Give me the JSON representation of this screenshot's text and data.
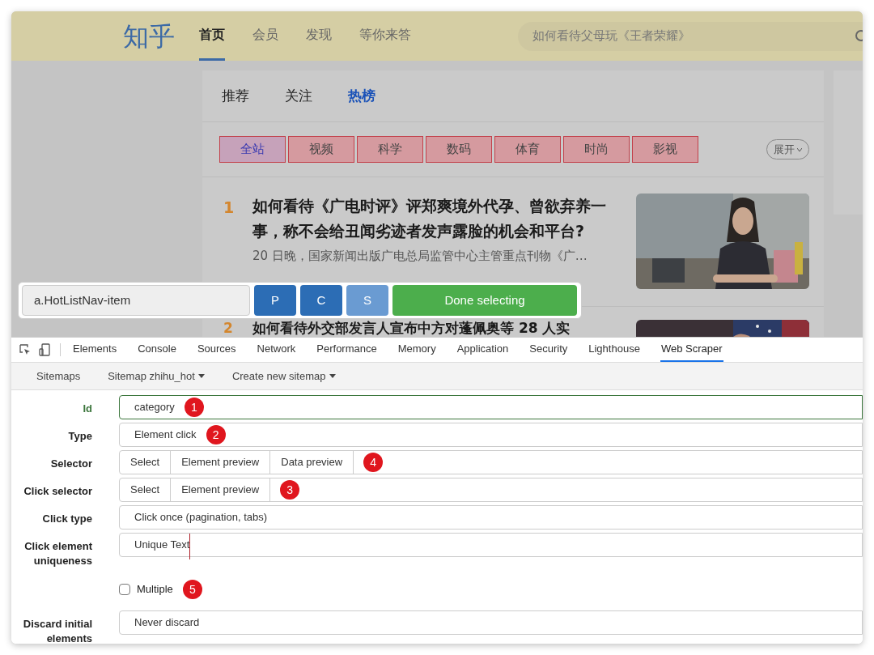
{
  "header": {
    "logo": "知乎",
    "nav": [
      {
        "label": "首页",
        "selected": true
      },
      {
        "label": "会员",
        "selected": false
      },
      {
        "label": "发现",
        "selected": false
      },
      {
        "label": "等你来答",
        "selected": false
      }
    ],
    "search": {
      "placeholder": "如何看待父母玩《王者荣耀》"
    }
  },
  "feed": {
    "tabs": [
      {
        "label": "推荐",
        "selected": false
      },
      {
        "label": "关注",
        "selected": false
      },
      {
        "label": "热榜",
        "selected": true
      }
    ],
    "categories": [
      {
        "label": "全站",
        "selected": true
      },
      {
        "label": "视频",
        "selected": false
      },
      {
        "label": "科学",
        "selected": false
      },
      {
        "label": "数码",
        "selected": false
      },
      {
        "label": "体育",
        "selected": false
      },
      {
        "label": "时尚",
        "selected": false
      },
      {
        "label": "影视",
        "selected": false
      }
    ],
    "expand": "展开",
    "items": [
      {
        "rank": "1",
        "title": "如何看待《广电时评》评郑爽境外代孕、曾欲弃养一事，称不会给丑闻劣迹者发声露脸的机会和平台?",
        "excerpt": "20 日晚，国家新闻出版广电总局监管中心主管重点刊物《广…"
      },
      {
        "rank": "2",
        "title": "如何看待外交部发言人宣布中方对蓬佩奥等 28 人实"
      }
    ]
  },
  "selector_toolbar": {
    "selector": "a.HotListNav-item",
    "buttons": [
      {
        "label": "P",
        "disabled": false
      },
      {
        "label": "C",
        "disabled": false
      },
      {
        "label": "S",
        "disabled": true
      }
    ],
    "done": "Done selecting"
  },
  "devtools": {
    "tabs": [
      {
        "label": "Elements",
        "selected": false
      },
      {
        "label": "Console",
        "selected": false
      },
      {
        "label": "Sources",
        "selected": false
      },
      {
        "label": "Network",
        "selected": false
      },
      {
        "label": "Performance",
        "selected": false
      },
      {
        "label": "Memory",
        "selected": false
      },
      {
        "label": "Application",
        "selected": false
      },
      {
        "label": "Security",
        "selected": false
      },
      {
        "label": "Lighthouse",
        "selected": false
      },
      {
        "label": "Web Scraper",
        "selected": true
      }
    ],
    "subnav": [
      {
        "label": "Sitemaps",
        "dropdown": false
      },
      {
        "label": "Sitemap zhihu_hot",
        "dropdown": true
      },
      {
        "label": "Create new sitemap",
        "dropdown": true
      }
    ],
    "form": [
      {
        "kind": "text",
        "label": "Id",
        "value": "category",
        "valid": true,
        "marker": "1"
      },
      {
        "kind": "text",
        "label": "Type",
        "value": "Element click",
        "valid": false,
        "marker": "2"
      },
      {
        "kind": "buttons",
        "label": "Selector",
        "buttons": [
          "Select",
          "Element preview",
          "Data preview"
        ],
        "marker": "4"
      },
      {
        "kind": "buttons",
        "label": "Click selector",
        "buttons": [
          "Select",
          "Element preview"
        ],
        "marker": "3"
      },
      {
        "kind": "text",
        "label": "Click type",
        "value": "Click once (pagination, tabs)",
        "valid": false
      },
      {
        "kind": "text",
        "label": "Click element uniqueness",
        "value": "Unique Text",
        "valid": false,
        "focused": true
      },
      {
        "kind": "checkbox",
        "option": "Multiple",
        "checked": false,
        "marker": "5"
      },
      {
        "kind": "text",
        "label": "Discard initial elements",
        "value": "Never discard",
        "valid": false
      }
    ]
  }
}
